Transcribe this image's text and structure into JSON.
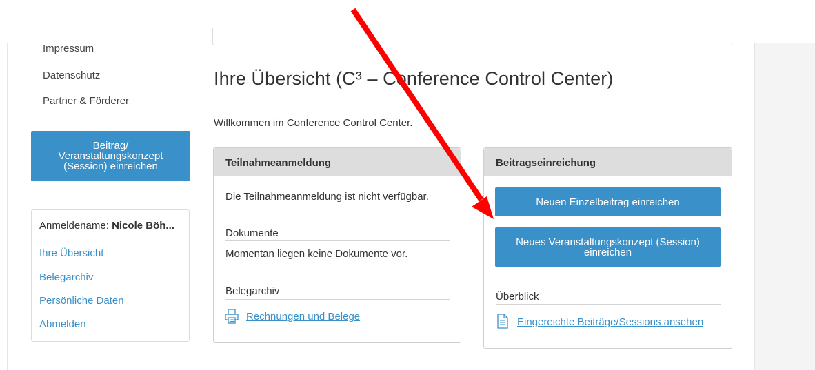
{
  "sidebar": {
    "footer_links": [
      "Impressum",
      "Datenschutz",
      "Partner & Förderer"
    ],
    "cta_lines": [
      "Beitrag/",
      "Veranstaltungskonzept",
      "(Session) einreichen"
    ],
    "user": {
      "label": "Anmeldename:",
      "name": "Nicole Böh...",
      "links": [
        "Ihre Übersicht",
        "Belegarchiv",
        "Persönliche Daten",
        "Abmelden"
      ]
    }
  },
  "main": {
    "title": "Ihre Übersicht (C³ – Conference Control Center)",
    "welcome": "Willkommen im Conference Control Center.",
    "registration": {
      "header": "Teilnahmeanmeldung",
      "text": "Die Teilnahmeanmeldung ist nicht verfügbar.",
      "documents_label": "Dokumente",
      "documents_text": "Momentan liegen keine Dokumente vor.",
      "archive_label": "Belegarchiv",
      "archive_link": "Rechnungen und Belege"
    },
    "submission": {
      "header": "Beitragseinreichung",
      "btn_single": "Neuen Einzelbeitrag einreichen",
      "btn_session_lines": [
        "Neues Veranstaltungskonzept (Session)",
        "einreichen"
      ],
      "overview_label": "Überblick",
      "overview_link": "Eingereichte Beiträge/Sessions ansehen"
    }
  },
  "colors": {
    "accent": "#3a91c9",
    "arrow": "#ff0000"
  },
  "icons": [
    "printer-icon",
    "document-icon",
    "red-arrow-annotation"
  ]
}
